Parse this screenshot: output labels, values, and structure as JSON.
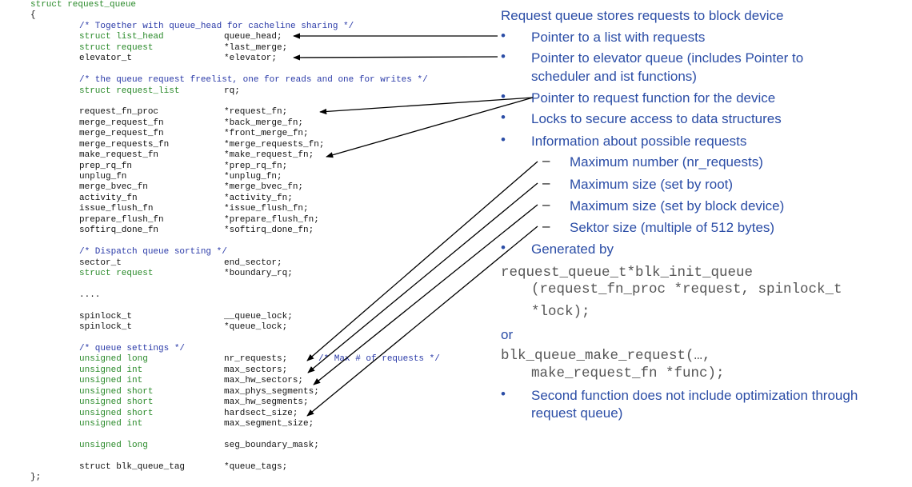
{
  "code_lines": [
    {
      "c1": "struct request_queue",
      "kw": true
    },
    {
      "c1": "{"
    },
    {
      "c2": "/* Together with queue_head for cacheline sharing */",
      "cm": true
    },
    {
      "c2": "struct list_head",
      "c3": "queue_head;",
      "kw": true
    },
    {
      "c2": "struct request",
      "c3": "*last_merge;",
      "kw": true
    },
    {
      "c2": "elevator_t",
      "c3": "*elevator;"
    },
    {},
    {
      "c2": "/* the queue request freelist, one for reads and one for writes */",
      "cm": true
    },
    {
      "c2": "struct request_list",
      "c3": "rq;",
      "kw": true
    },
    {},
    {
      "c2": "request_fn_proc",
      "c3": "*request_fn;"
    },
    {
      "c2": "merge_request_fn",
      "c3": "*back_merge_fn;"
    },
    {
      "c2": "merge_request_fn",
      "c3": "*front_merge_fn;"
    },
    {
      "c2": "merge_requests_fn",
      "c3": "*merge_requests_fn;"
    },
    {
      "c2": "make_request_fn",
      "c3": "*make_request_fn;"
    },
    {
      "c2": "prep_rq_fn",
      "c3": "*prep_rq_fn;"
    },
    {
      "c2": "unplug_fn",
      "c3": "*unplug_fn;"
    },
    {
      "c2": "merge_bvec_fn",
      "c3": "*merge_bvec_fn;"
    },
    {
      "c2": "activity_fn",
      "c3": "*activity_fn;"
    },
    {
      "c2": "issue_flush_fn",
      "c3": "*issue_flush_fn;"
    },
    {
      "c2": "prepare_flush_fn",
      "c3": "*prepare_flush_fn;"
    },
    {
      "c2": "softirq_done_fn",
      "c3": "*softirq_done_fn;"
    },
    {},
    {
      "c2": "/* Dispatch queue sorting */",
      "cm": true
    },
    {
      "c2": "sector_t",
      "c3": "end_sector;"
    },
    {
      "c2": "struct request",
      "c3": "*boundary_rq;",
      "kw": true
    },
    {},
    {
      "c2": "...."
    },
    {},
    {
      "c2": "spinlock_t",
      "c3": "__queue_lock;"
    },
    {
      "c2": "spinlock_t",
      "c3": "*queue_lock;"
    },
    {},
    {
      "c2": "/* queue settings */",
      "cm": true
    },
    {
      "c2": "unsigned long",
      "c3": "nr_requests;",
      "c4": "/* Max # of requests */",
      "kw": true
    },
    {
      "c2": "unsigned int",
      "c3": "max_sectors;",
      "kw": true
    },
    {
      "c2": "unsigned int",
      "c3": "max_hw_sectors;",
      "kw": true
    },
    {
      "c2": "unsigned short",
      "c3": "max_phys_segments;",
      "kw": true
    },
    {
      "c2": "unsigned short",
      "c3": "max_hw_segments;",
      "kw": true
    },
    {
      "c2": "unsigned short",
      "c3": "hardsect_size;",
      "kw": true
    },
    {
      "c2": "unsigned int",
      "c3": "max_segment_size;",
      "kw": true
    },
    {},
    {
      "c2": "unsigned long",
      "c3": "seg_boundary_mask;",
      "kw": true
    },
    {},
    {
      "c2": "struct blk_queue_tag",
      "c3": "*queue_tags;"
    },
    {
      "c1": "};"
    }
  ],
  "notes": {
    "heading": "Request queue stores requests to block device",
    "bullet_char": "•",
    "dash_char": "–",
    "b1": "Pointer to a list with requests",
    "b2a": "Pointer to elevator queue (includes Pointer to",
    "b2b": "scheduler and ist functions)",
    "b3": "Pointer to request function for the device",
    "b4": "Locks to secure access to data structures",
    "b5": "Information about possible requests",
    "s1": "Maximum number (nr_requests)",
    "s2": "Maximum size (set by root)",
    "s3": "Maximum size (set by block device)",
    "s4": "Sektor size (multiple of 512 bytes)",
    "b6": "Generated by",
    "code1a": "request_queue_t*blk_init_queue",
    "code1b": "(request_fn_proc *request, spinlock_t",
    "code1c": "*lock);",
    "or": "or",
    "code2a": "blk_queue_make_request(…,",
    "code2b": "make_request_fn *func);",
    "b7a": "Second function does not include optimization through",
    "b7b": "request queue)"
  },
  "colors": {
    "notes_text": "#2b4da6",
    "code_keyword": "#2a8a2a",
    "code_comment": "#2a3aa8",
    "code_text": "#111111",
    "arrows": "#000000"
  }
}
